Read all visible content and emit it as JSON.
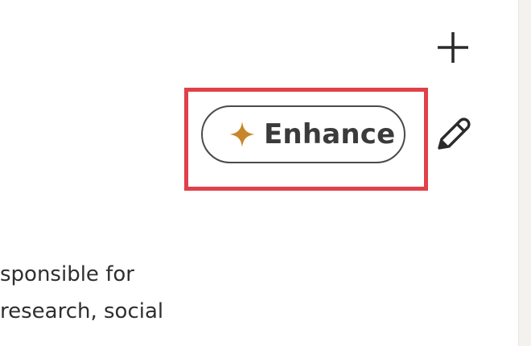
{
  "actions": {
    "add_icon": "plus-icon",
    "edit_icon": "pencil-icon"
  },
  "enhance": {
    "label": "Enhance",
    "icon": "sparkle-icon",
    "icon_color": "#c8862a",
    "highlight_color": "#e0414a"
  },
  "description": {
    "lines": [
      "sponsible for",
      " research, social"
    ]
  }
}
